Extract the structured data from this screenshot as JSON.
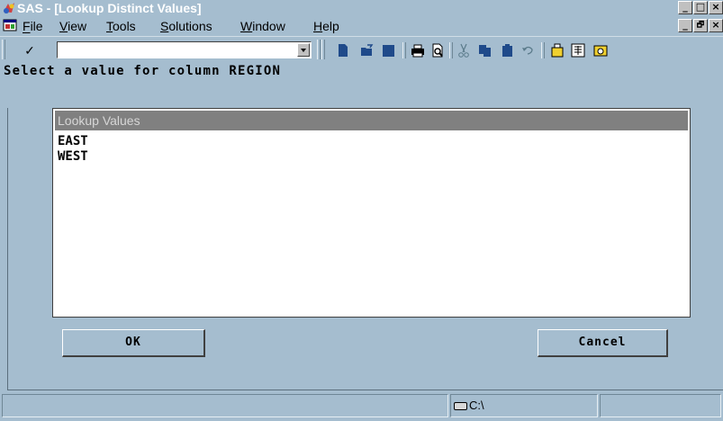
{
  "window": {
    "title": "SAS - [Lookup Distinct Values]",
    "controls": [
      "_",
      "□",
      "×"
    ],
    "mdi_controls": [
      "_",
      "🗗",
      "×"
    ]
  },
  "menu": [
    {
      "label": "File",
      "underline": "F"
    },
    {
      "label": "View",
      "underline": "V"
    },
    {
      "label": "Tools",
      "underline": "T"
    },
    {
      "label": "Solutions",
      "underline": "S"
    },
    {
      "label": "Window",
      "underline": "W"
    },
    {
      "label": "Help",
      "underline": "H"
    }
  ],
  "toolbar": {
    "check_glyph": "✓",
    "command_value": "",
    "icons": [
      "new-icon",
      "open-icon",
      "save-icon",
      "print-icon",
      "print-preview-icon",
      "cut-icon",
      "copy-icon",
      "paste-icon",
      "undo-icon",
      "explorer-icon",
      "library-icon",
      "query-icon"
    ]
  },
  "dialog": {
    "prompt": "Select a value for column REGION",
    "list_header": "Lookup Values",
    "values": [
      "EAST",
      "WEST"
    ],
    "ok_label": "OK",
    "cancel_label": "Cancel"
  },
  "status": {
    "path": "C:\\"
  },
  "colors": {
    "background": "#a5bdcf",
    "list_header": "#808080"
  }
}
